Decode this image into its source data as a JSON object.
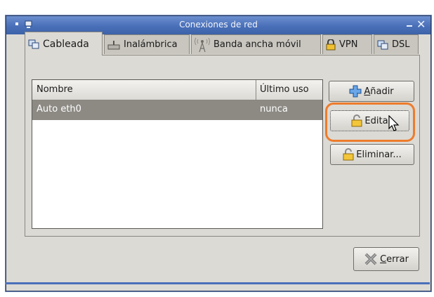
{
  "window": {
    "title": "Conexiones de red",
    "icons": [
      "menu-icon",
      "network-app-icon",
      "minimize-icon",
      "close-icon"
    ]
  },
  "tabs": [
    {
      "label": "Cableada",
      "icon": "wired-network-icon",
      "active": true
    },
    {
      "label": "Inalámbrica",
      "icon": "wireless-card-icon",
      "active": false
    },
    {
      "label": "Banda ancha móvil",
      "icon": "antenna-icon",
      "active": false
    },
    {
      "label": "VPN",
      "icon": "lock-icon",
      "active": false
    },
    {
      "label": "DSL",
      "icon": "dsl-network-icon",
      "active": false
    }
  ],
  "table": {
    "columns": [
      "Nombre",
      "Último uso"
    ],
    "rows": [
      {
        "name": "Auto eth0",
        "last_used": "nunca",
        "selected": true
      }
    ]
  },
  "buttons": {
    "add": {
      "prefix": "",
      "mnemonic": "A",
      "rest": "ñadir",
      "icon": "plus-icon"
    },
    "edit": {
      "label": "Edita",
      "icon": "padlock-icon",
      "focused": true
    },
    "delete": {
      "label": "Eliminar...",
      "icon": "padlock-icon"
    },
    "close": {
      "prefix": "",
      "mnemonic": "C",
      "rest": "errar",
      "icon": "x-icon"
    }
  },
  "colors": {
    "titlebar": "#4a70b9",
    "selection": "#8d8a84",
    "focus_highlight": "#ee7c2c"
  }
}
